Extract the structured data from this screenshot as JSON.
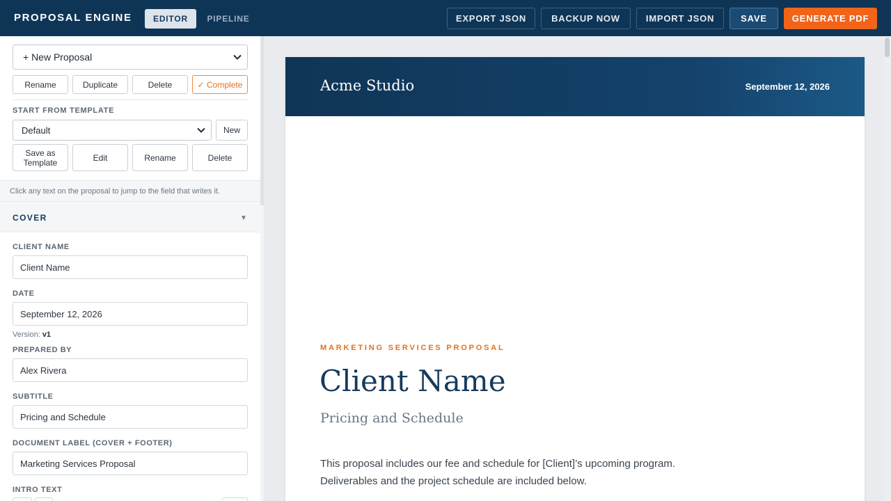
{
  "app": {
    "brand": "PROPOSAL ENGINE",
    "tabs": [
      {
        "label": "EDITOR",
        "active": true
      },
      {
        "label": "PIPELINE",
        "active": false
      }
    ],
    "actions": {
      "export_json": "EXPORT JSON",
      "backup_now": "BACKUP NOW",
      "import_json": "IMPORT JSON",
      "save": "SAVE",
      "generate_pdf": "GENERATE PDF"
    },
    "colors": {
      "topbar": "#0f3556",
      "accent": "#f26419",
      "heading": "#163a5c"
    }
  },
  "sidebar": {
    "proposal_select": {
      "value": "+ New Proposal"
    },
    "proposal_buttons": {
      "rename": "Rename",
      "duplicate": "Duplicate",
      "delete": "Delete",
      "complete": "✓ Complete"
    },
    "template": {
      "heading": "START FROM TEMPLATE",
      "select_value": "Default",
      "new": "New",
      "save_as_template": "Save as Template",
      "edit": "Edit",
      "rename": "Rename",
      "delete": "Delete"
    },
    "hint": "Click any text on the proposal to jump to the field that writes it.",
    "cover": {
      "heading": "COVER",
      "arrow": "▼",
      "client_name_label": "CLIENT NAME",
      "client_name_value": "Client Name",
      "date_label": "DATE",
      "date_value": "September 12, 2026",
      "version_label": "Version:",
      "version_value": "v1",
      "prepared_by_label": "PREPARED BY",
      "prepared_by_value": "Alex Rivera",
      "subtitle_label": "SUBTITLE",
      "subtitle_value": "Pricing and Schedule",
      "doc_label_label": "DOCUMENT LABEL (COVER + FOOTER)",
      "doc_label_value": "Marketing Services Proposal",
      "intro_label": "INTRO TEXT"
    }
  },
  "preview": {
    "studio": "Acme Studio",
    "date": "September 12, 2026",
    "eyebrow": "MARKETING SERVICES PROPOSAL",
    "client_name": "Client Name",
    "subtitle": "Pricing and Schedule",
    "intro_line1": "This proposal includes our fee and schedule for [Client]’s upcoming program.",
    "intro_line2": "Deliverables and the project schedule are included below."
  }
}
